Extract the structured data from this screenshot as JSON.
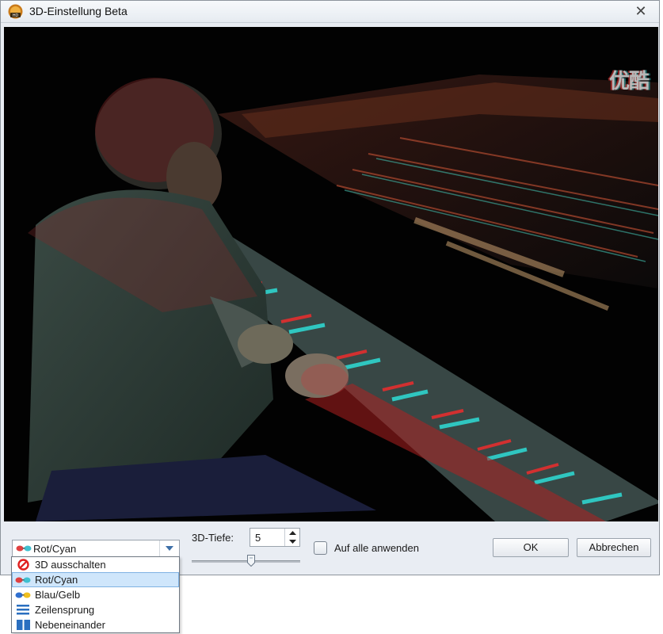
{
  "window": {
    "title": "3D-Einstellung Beta"
  },
  "video": {
    "watermark": "优酷"
  },
  "controls": {
    "mode_selected": "Rot/Cyan",
    "depth_label": "3D-Tiefe:",
    "depth_value": "5",
    "apply_all_label": "Auf alle anwenden",
    "apply_all_checked": false,
    "ok_label": "OK",
    "cancel_label": "Abbrechen"
  },
  "dropdown": {
    "options": [
      {
        "label": "3D ausschalten",
        "icon": "disable-icon"
      },
      {
        "label": "Rot/Cyan",
        "icon": "red-cyan-glasses-icon",
        "selected": true
      },
      {
        "label": "Blau/Gelb",
        "icon": "blue-yellow-glasses-icon"
      },
      {
        "label": "Zeilensprung",
        "icon": "interlaced-lines-icon"
      },
      {
        "label": "Nebeneinander",
        "icon": "side-by-side-icon"
      }
    ]
  }
}
